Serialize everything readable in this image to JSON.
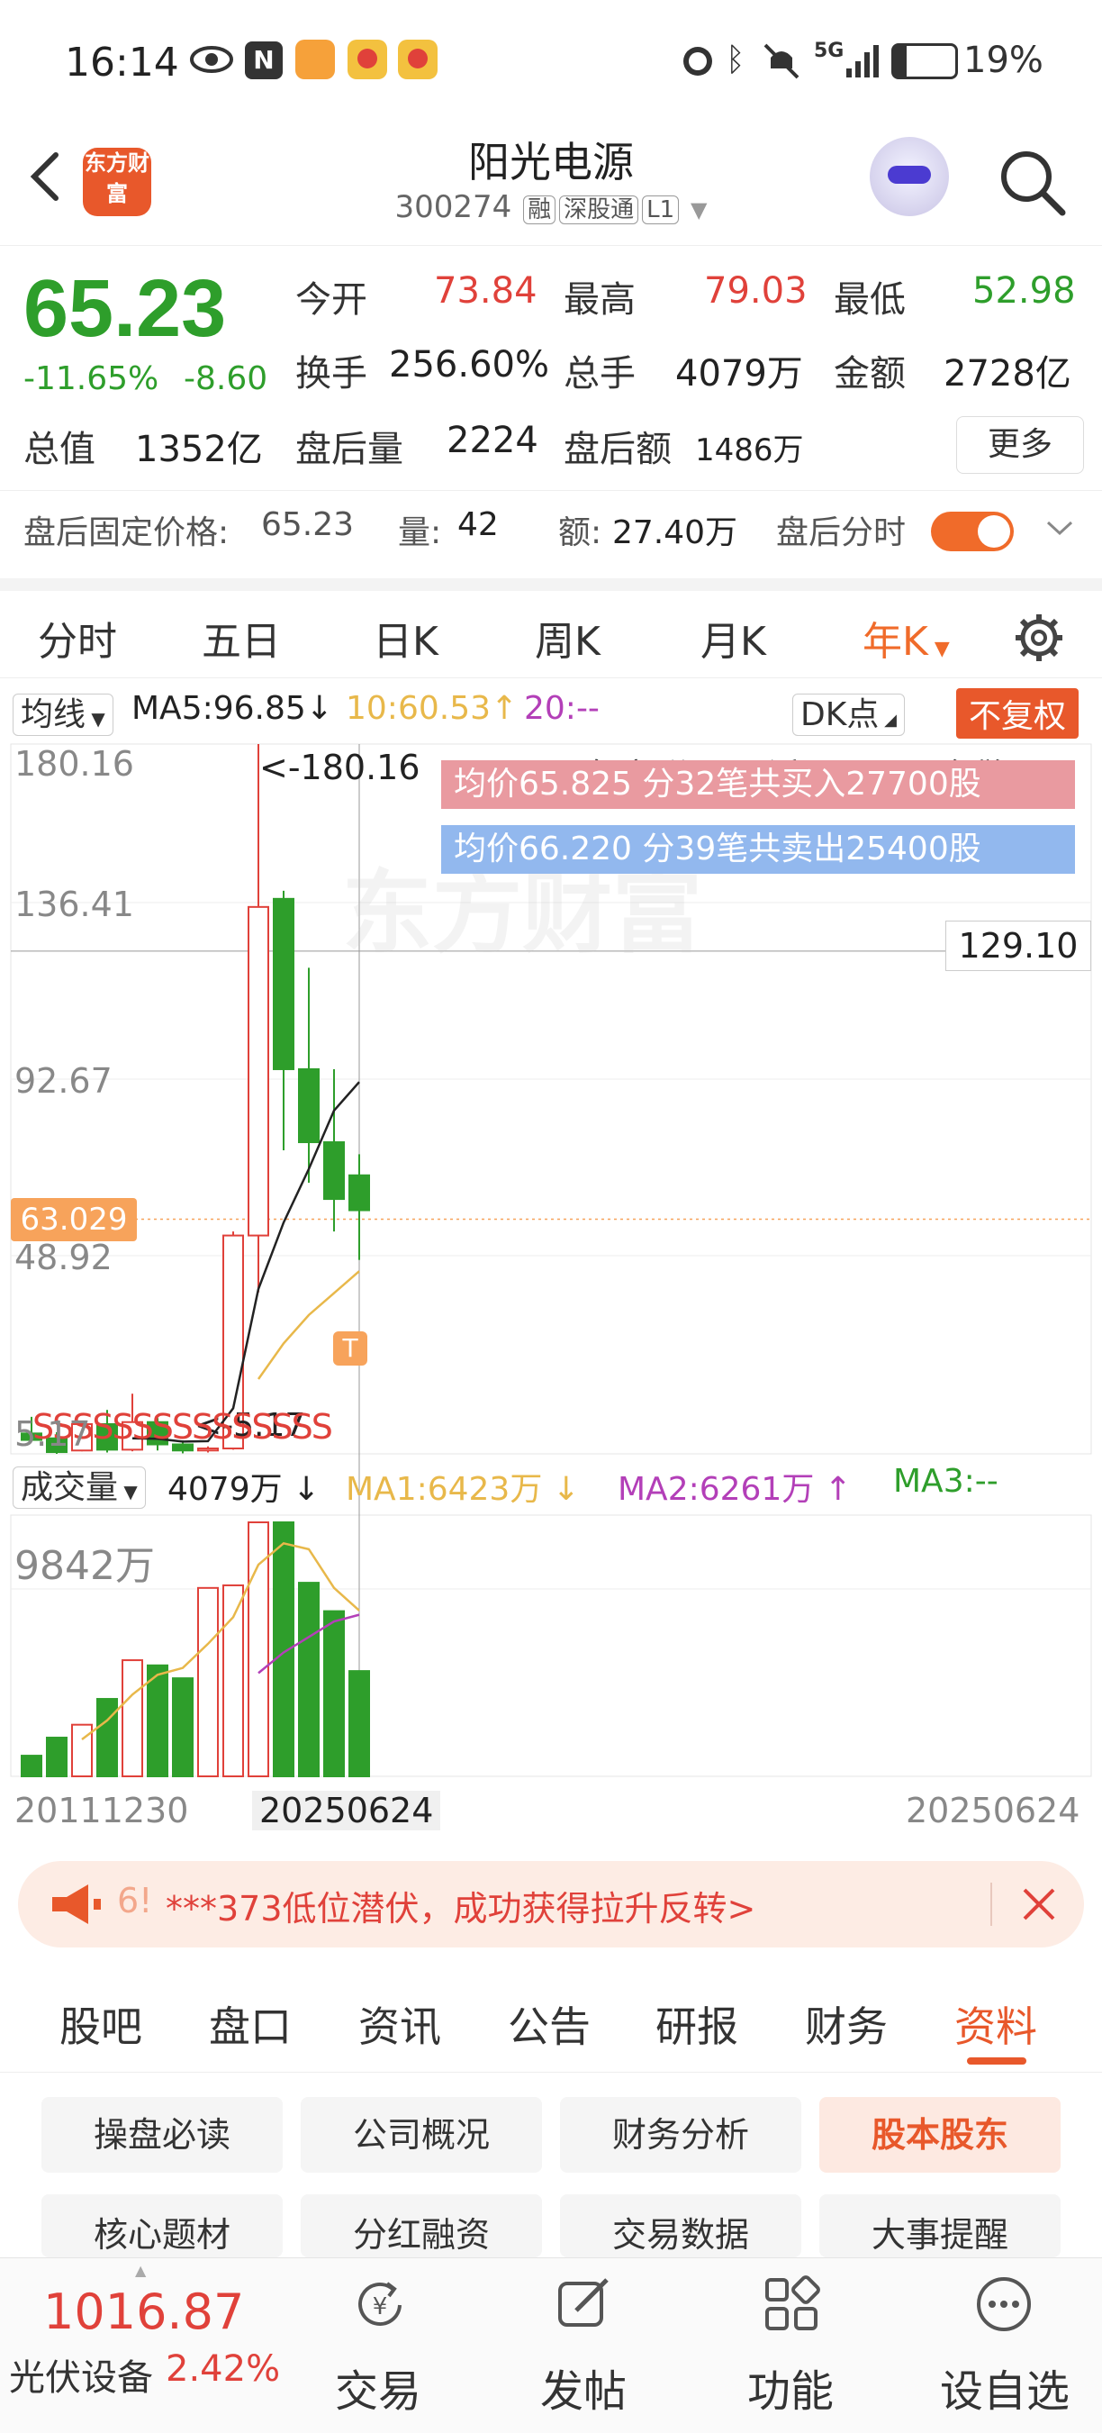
{
  "status": {
    "time": "16:14",
    "battery": "19%",
    "network": "5G"
  },
  "header": {
    "logo_text": "东方财富",
    "title": "阳光电源",
    "code": "300274",
    "tags": [
      "融",
      "深股通",
      "L1"
    ]
  },
  "quote": {
    "price": "65.23",
    "change_pct": "-11.65%",
    "change": "-8.60",
    "open_label": "今开",
    "open": "73.84",
    "high_label": "最高",
    "high": "79.03",
    "low_label": "最低",
    "low": "52.98",
    "turnover_label": "换手",
    "turnover": "256.60%",
    "volume_label": "总手",
    "volume": "4079万",
    "amount_label": "金额",
    "amount": "2728亿",
    "mktcap_label": "总值",
    "mktcap": "1352亿",
    "ah_vol_label": "盘后量",
    "ah_vol": "2224",
    "ah_amt_label": "盘后额",
    "ah_amt": "1486万",
    "more": "更多",
    "after_fixed_label": "盘后固定价格:",
    "after_fixed_price": "65.23",
    "after_qty_label": "量:",
    "after_qty": "42",
    "after_amt_label": "额:",
    "after_amt": "27.40万",
    "after_timeshare": "盘后分时"
  },
  "kline_tabs": [
    "分时",
    "五日",
    "日K",
    "周K",
    "月K",
    "年K"
  ],
  "active_tab": "年K",
  "chart": {
    "ma_selector": "均线",
    "ma5": "MA5:96.85",
    "ma10": "10:60.53",
    "ma20": "20:--",
    "dk": "DK点",
    "adjust": "不复权",
    "dividend_note": "2024年度 分配12派10.80元(含税)",
    "buy_note": "均价65.825  分32笔共买入27700股",
    "sell_note": "均价66.220  分39笔共卖出25400股",
    "max_label": "<-180.16",
    "min_label": "<-5.17",
    "y_labels": [
      "180.16",
      "136.41",
      "92.67",
      "48.92",
      "5.17"
    ],
    "crosshair_price": "129.10",
    "cursor_price": "63.029",
    "watermark": "东方财富",
    "vol_selector": "成交量",
    "vol_value": "4079万",
    "vol_ma1": "MA1:6423万",
    "vol_ma2": "MA2:6261万",
    "vol_ma3": "MA3:--",
    "vol_max": "9842万",
    "x_start": "20111230",
    "x_cursor": "20250624",
    "x_end": "20250624",
    "colors": {
      "up": "#e0413a",
      "down": "#2e9e2b",
      "ma5": "#222222",
      "ma10": "#e8b84a",
      "ma20": "#b33fb8"
    }
  },
  "chart_data": {
    "type": "candlestick",
    "title": "",
    "ylim": [
      5.17,
      180.16
    ],
    "candles": [
      {
        "o": 10.2,
        "h": 14.3,
        "l": 9.2,
        "c": 8.6
      },
      {
        "o": 9.0,
        "h": 10.5,
        "l": 5.17,
        "c": 5.6
      },
      {
        "o": 6.0,
        "h": 13.0,
        "l": 5.8,
        "c": 12.5
      },
      {
        "o": 12.5,
        "h": 16.0,
        "l": 5.5,
        "c": 6.2
      },
      {
        "o": 6.2,
        "h": 20.0,
        "l": 5.8,
        "c": 13.0
      },
      {
        "o": 13.0,
        "h": 14.0,
        "l": 6.0,
        "c": 7.5
      },
      {
        "o": 7.5,
        "h": 8.5,
        "l": 5.3,
        "c": 6.0
      },
      {
        "o": 6.0,
        "h": 7.0,
        "l": 5.5,
        "c": 6.5
      },
      {
        "o": 6.5,
        "h": 60.0,
        "l": 6.2,
        "c": 59.0
      },
      {
        "o": 59.0,
        "h": 180.16,
        "l": 45.0,
        "c": 140.0
      },
      {
        "o": 142.0,
        "h": 144.0,
        "l": 80.0,
        "c": 100.0
      },
      {
        "o": 100.0,
        "h": 125.0,
        "l": 72.0,
        "c": 82.0
      },
      {
        "o": 82.0,
        "h": 100.0,
        "l": 60.0,
        "c": 68.0
      },
      {
        "o": 73.84,
        "h": 79.03,
        "l": 52.98,
        "c": 65.23
      }
    ],
    "ma5": [
      null,
      null,
      null,
      null,
      9.0,
      8.9,
      8.2,
      8.3,
      16.4,
      45.8,
      62.2,
      75.4,
      89.8,
      96.85
    ],
    "ma10": [
      null,
      null,
      null,
      null,
      null,
      null,
      null,
      null,
      null,
      23.6,
      32.4,
      39.4,
      44.8,
      50.2
    ],
    "volume": [
      800,
      1500,
      2000,
      3000,
      4500,
      4300,
      3800,
      7300,
      7400,
      9842,
      9842,
      7500,
      6400,
      4079
    ],
    "volume_ma1": [
      null,
      null,
      1433,
      2167,
      3167,
      3933,
      4200,
      5133,
      6167,
      8200,
      9028,
      8800,
      7300,
      6423
    ],
    "volume_ma2": [
      null,
      null,
      null,
      null,
      null,
      null,
      null,
      null,
      null,
      4000,
      4800,
      5400,
      6000,
      6261
    ]
  },
  "ad": {
    "text": "***373低位潜伏，成功获得拉升反转>"
  },
  "bottom_tabs": [
    "股吧",
    "盘口",
    "资讯",
    "公告",
    "研报",
    "财务",
    "资料"
  ],
  "grid_buttons": [
    [
      "操盘必读",
      "公司概况",
      "财务分析",
      "股本股东"
    ],
    [
      "核心题材",
      "分红融资",
      "交易数据",
      "大事提醒"
    ]
  ],
  "bottom_nav": {
    "index_value": "1016.87",
    "index_name": "光伏设备",
    "index_change": "2.42%",
    "trade": "交易",
    "post": "发帖",
    "function": "功能",
    "watch": "设自选"
  }
}
